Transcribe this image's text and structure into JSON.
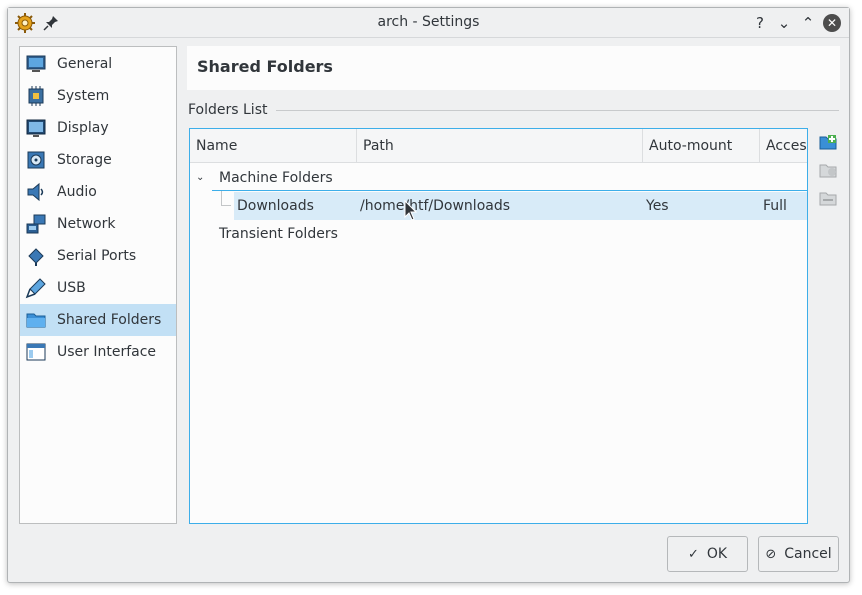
{
  "window": {
    "title": "arch - Settings",
    "titlebar_buttons": [
      "help",
      "minimize",
      "maximize",
      "close"
    ],
    "help_label": "?",
    "minimize_label": "⌄",
    "maximize_label": "⌃",
    "close_label": "✕"
  },
  "sidebar": {
    "items": [
      {
        "label": "General",
        "icon": "monitor-icon"
      },
      {
        "label": "System",
        "icon": "chip-icon"
      },
      {
        "label": "Display",
        "icon": "display-icon"
      },
      {
        "label": "Storage",
        "icon": "disk-icon"
      },
      {
        "label": "Audio",
        "icon": "speaker-icon"
      },
      {
        "label": "Network",
        "icon": "network-icon"
      },
      {
        "label": "Serial Ports",
        "icon": "serial-port-icon"
      },
      {
        "label": "USB",
        "icon": "usb-icon"
      },
      {
        "label": "Shared Folders",
        "icon": "folder-icon",
        "selected": true
      },
      {
        "label": "User Interface",
        "icon": "window-icon"
      }
    ]
  },
  "page": {
    "title": "Shared Folders",
    "group_label": "Folders List"
  },
  "table": {
    "columns": [
      "Name",
      "Path",
      "Auto-mount",
      "Acces"
    ],
    "machine_group": "Machine Folders",
    "transient_group": "Transient Folders",
    "rows": [
      {
        "name": "Downloads",
        "path": "/home/htf/Downloads",
        "automount": "Yes",
        "access": "Full"
      }
    ]
  },
  "buttons": {
    "ok": "OK",
    "cancel": "Cancel",
    "ok_icon": "✓",
    "cancel_icon": "⊘"
  },
  "colors": {
    "accent": "#3daee9",
    "selection": "#c2e0f5",
    "row_selection": "#d8ebf8"
  }
}
